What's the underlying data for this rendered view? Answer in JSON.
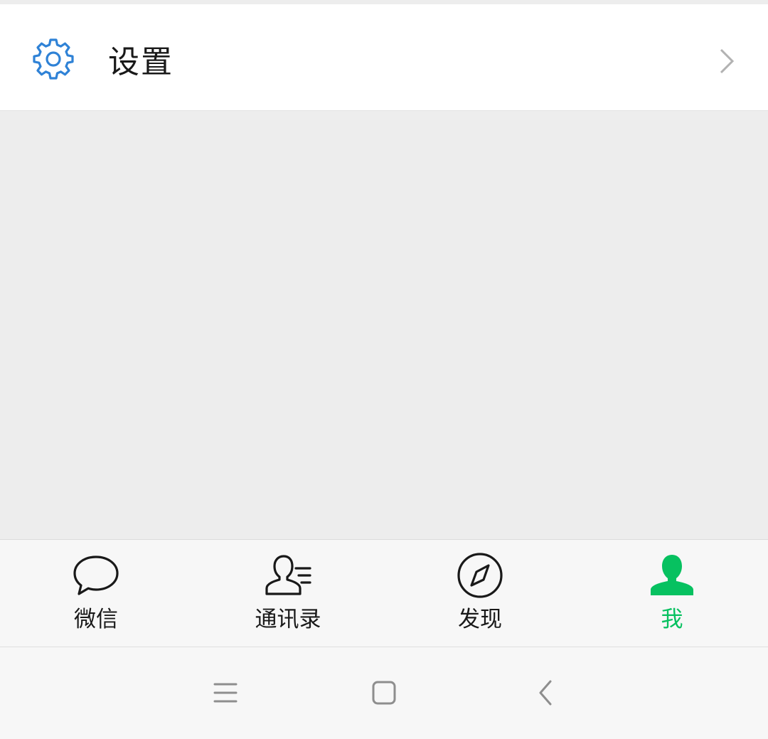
{
  "settings": {
    "label": "设置",
    "icon": "gear-icon",
    "chevron_icon": "chevron-right-icon",
    "icon_color": "#2f82d6"
  },
  "tabbar": {
    "active_color": "#07c160",
    "tabs": [
      {
        "label": "微信",
        "icon": "chat-bubble-icon",
        "active": false
      },
      {
        "label": "通讯录",
        "icon": "contacts-icon",
        "active": false
      },
      {
        "label": "发现",
        "icon": "compass-icon",
        "active": false
      },
      {
        "label": "我",
        "icon": "person-icon",
        "active": true
      }
    ]
  },
  "system_nav": {
    "buttons": [
      {
        "icon": "menu-icon"
      },
      {
        "icon": "home-square-icon"
      },
      {
        "icon": "back-icon"
      }
    ]
  }
}
